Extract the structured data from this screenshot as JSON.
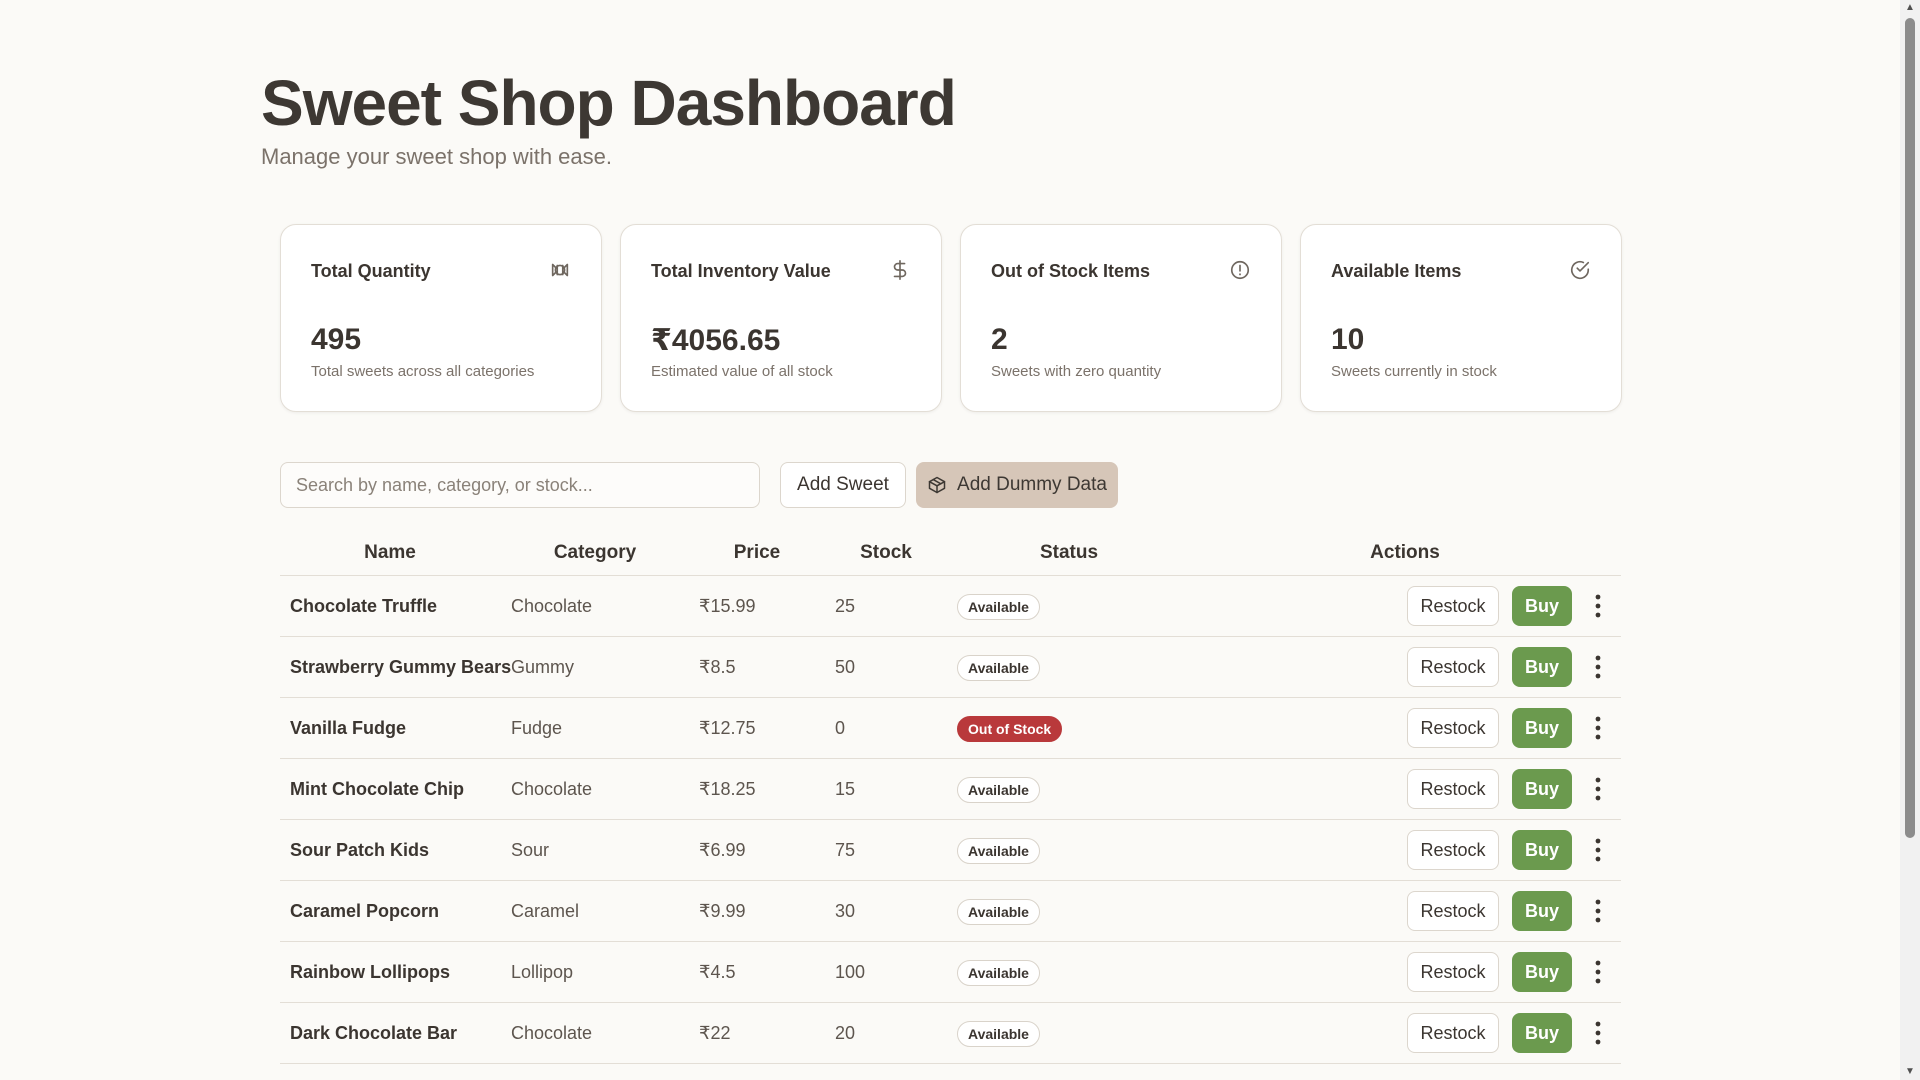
{
  "header": {
    "title": "Sweet Shop Dashboard",
    "subtitle": "Manage your sweet shop with ease."
  },
  "cards": [
    {
      "title": "Total Quantity",
      "value": "495",
      "desc": "Total sweets across all categories",
      "icon": "candy-icon"
    },
    {
      "title": "Total Inventory Value",
      "value": "₹4056.65",
      "desc": "Estimated value of all stock",
      "icon": "dollar-icon"
    },
    {
      "title": "Out of Stock Items",
      "value": "2",
      "desc": "Sweets with zero quantity",
      "icon": "alert-circle-icon"
    },
    {
      "title": "Available Items",
      "value": "10",
      "desc": "Sweets currently in stock",
      "icon": "check-circle-icon"
    }
  ],
  "toolbar": {
    "search_placeholder": "Search by name, category, or stock...",
    "add_label": "Add Sweet",
    "dummy_label": "Add Dummy Data"
  },
  "table": {
    "headers": [
      "Name",
      "Category",
      "Price",
      "Stock",
      "Status",
      "Actions"
    ],
    "restock_label": "Restock",
    "buy_label": "Buy",
    "rows": [
      {
        "name": "Chocolate Truffle",
        "category": "Chocolate",
        "price": "₹15.99",
        "stock": "25",
        "status": "Available"
      },
      {
        "name": "Strawberry Gummy Bears",
        "category": "Gummy",
        "price": "₹8.5",
        "stock": "50",
        "status": "Available"
      },
      {
        "name": "Vanilla Fudge",
        "category": "Fudge",
        "price": "₹12.75",
        "stock": "0",
        "status": "Out of Stock"
      },
      {
        "name": "Mint Chocolate Chip",
        "category": "Chocolate",
        "price": "₹18.25",
        "stock": "15",
        "status": "Available"
      },
      {
        "name": "Sour Patch Kids",
        "category": "Sour",
        "price": "₹6.99",
        "stock": "75",
        "status": "Available"
      },
      {
        "name": "Caramel Popcorn",
        "category": "Caramel",
        "price": "₹9.99",
        "stock": "30",
        "status": "Available"
      },
      {
        "name": "Rainbow Lollipops",
        "category": "Lollipop",
        "price": "₹4.5",
        "stock": "100",
        "status": "Available"
      },
      {
        "name": "Dark Chocolate Bar",
        "category": "Chocolate",
        "price": "₹22",
        "stock": "20",
        "status": "Available"
      }
    ]
  },
  "colors": {
    "background": "#fbfaf7",
    "buy_button": "#6b9a4e",
    "out_of_stock_badge": "#b9393b",
    "dummy_button": "#d6c6b8"
  }
}
